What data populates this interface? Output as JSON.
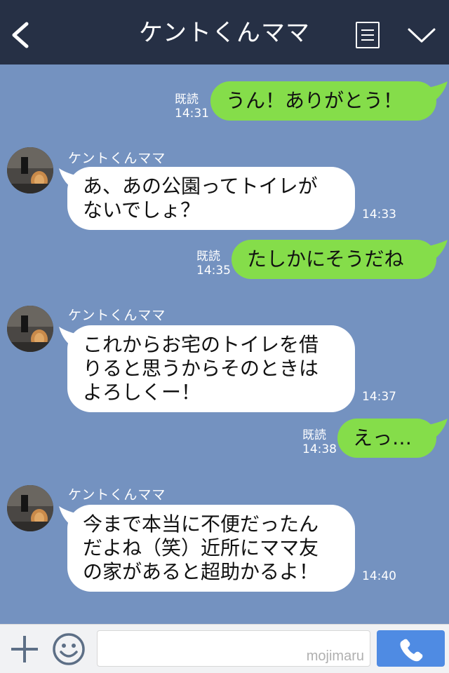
{
  "header": {
    "title": "ケントくんママ",
    "back_icon": "chevron-left-icon",
    "menu_icon": "list-icon",
    "collapse_icon": "chevron-down-icon"
  },
  "messages": [
    {
      "side": "out",
      "text": "うん！ありがとう！",
      "read": "既読",
      "time": "14:31"
    },
    {
      "side": "in",
      "sender": "ケントくんママ",
      "lines": [
        "あ、あの公園ってトイレが",
        "ないでしょ？"
      ],
      "time": "14:33"
    },
    {
      "side": "out",
      "text": "たしかにそうだね",
      "read": "既読",
      "time": "14:35"
    },
    {
      "side": "in",
      "sender": "ケントくんママ",
      "lines": [
        "これからお宅のトイレを借",
        "りると思うからそのときは",
        "よろしくー！"
      ],
      "time": "14:37"
    },
    {
      "side": "out",
      "text": "えっ…",
      "read": "既読",
      "time": "14:38"
    },
    {
      "side": "in",
      "sender": "ケントくんママ",
      "lines": [
        "今まで本当に不便だったん",
        "だよね（笑）近所にママ友",
        "の家があると超助かるよ！"
      ],
      "time": "14:40"
    }
  ],
  "input": {
    "watermark": "mojimaru",
    "plus_icon": "plus-icon",
    "emoji_icon": "smiley-icon",
    "call_icon": "phone-icon"
  },
  "colors": {
    "header_bg": "#263045",
    "chat_bg": "#7492c0",
    "outgoing_bubble": "#85dd4a",
    "incoming_bubble": "#ffffff",
    "call_button": "#4f8be3"
  }
}
